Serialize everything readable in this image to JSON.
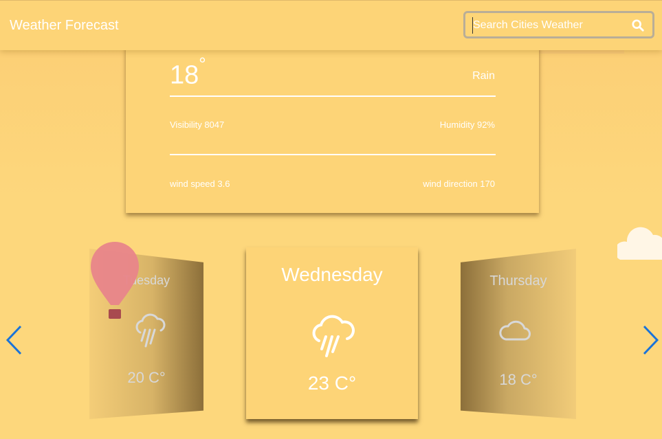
{
  "header": {
    "title": "Weather Forecast",
    "search_placeholder": "Search Cities Weather"
  },
  "current": {
    "temperature": "18",
    "degree_symbol": "°",
    "condition": "Rain",
    "visibility": "Visibility 8047",
    "humidity": "Humidity 92%",
    "wind_speed": "wind speed 3.6",
    "wind_direction": "wind direction 170"
  },
  "carousel": {
    "days": [
      {
        "day": "Tuesday",
        "temp": "20 C°",
        "icon": "rain-cloud-icon"
      },
      {
        "day": "Wednesday",
        "temp": "23 C°",
        "icon": "rain-cloud-icon"
      },
      {
        "day": "Thursday",
        "temp": "18 C°",
        "icon": "cloud-icon"
      }
    ]
  },
  "colors": {
    "background": "#fdd77c",
    "card": "#fdd477",
    "text": "#ffffff",
    "arrow": "#1a73d9",
    "balloon": "#e8858a"
  }
}
